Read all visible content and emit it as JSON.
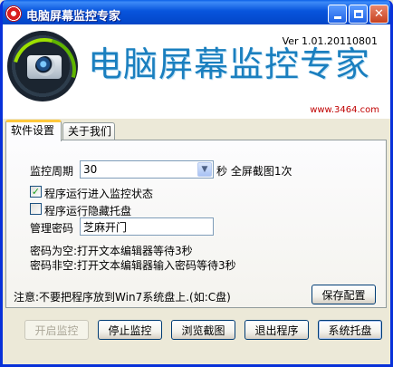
{
  "window": {
    "title": "电脑屏幕监控专家",
    "minimize_label": "",
    "maximize_label": "",
    "close_label": "✕"
  },
  "banner": {
    "title": "电脑屏幕监控专家",
    "version": "Ver 1.01.20110801",
    "url": "www.3464.com",
    "logo_icon": "camera-logo-icon"
  },
  "tabs": [
    {
      "label": "软件设置",
      "active": true
    },
    {
      "label": "关于我们",
      "active": false
    }
  ],
  "settings": {
    "period_label": "监控周期",
    "period_value": "30",
    "period_suffix": "秒 全屏截图1次",
    "auto_monitor_label": "程序运行进入监控状态",
    "auto_monitor_checked": true,
    "hide_tray_label": "程序运行隐藏托盘",
    "hide_tray_checked": false,
    "password_label": "管理密码",
    "password_value": "芝麻开门",
    "hint_empty": "密码为空:打开文本编辑器等待3秒",
    "hint_nonempty": "密码非空:打开文本编辑器输入密码等待3秒"
  },
  "footer": {
    "note": "注意:不要把程序放到Win7系统盘上.(如:C盘)",
    "save_label": "保存配置"
  },
  "actions": {
    "start_label": "开启监控",
    "stop_label": "停止监控",
    "browse_label": "浏览截图",
    "exit_label": "退出程序",
    "tray_label": "系统托盘"
  },
  "colors": {
    "titlebar": "#0855dd",
    "banner_title": "#1a7fbf",
    "url": "#c00000",
    "tab_highlight": "#ffc83c"
  }
}
